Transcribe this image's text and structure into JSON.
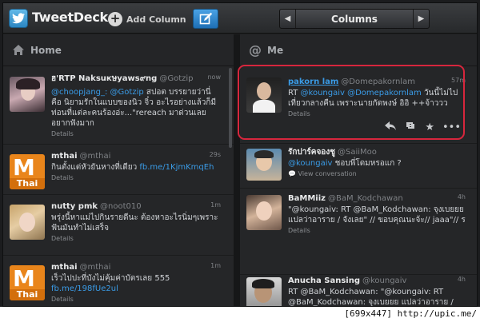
{
  "app": {
    "title": "TweetDeck",
    "add_column": "Add Column"
  },
  "column_nav": {
    "label": "Columns",
    "left": "◀",
    "right": "▶"
  },
  "columns": {
    "home": {
      "title": "Home",
      "tweets": [
        {
          "name": "ฮ'RTP Naksuкษyaws๙ng",
          "handle": "@Gotzip",
          "time": "now",
          "text_pre": "",
          "mention": "@choopjang_: @Gotzip",
          "text": " สปอต บรรยายว่านี่คือ นิยามรักในแบบของนิว จิ๋ว อะไรอย่างแล้วก็มีท่อนที่แต่ละคนร้องอ่ะ...\"rereach มาด่วนเลย อยากฟังมาก",
          "details": "Details"
        },
        {
          "name": "mthai",
          "handle": "@mthai",
          "time": "29s",
          "text": "กินตั้งแต่หัวยันหางที่เดียว ",
          "link": "fb.me/1KjmKmqEh",
          "details": "Details"
        },
        {
          "name": "nutty pmk",
          "handle": "@noot010",
          "time": "1m",
          "text": "พรุ่งนี้หาแม่ไปกินรายดีนะ ต้องหาอะไรนิ่มๆเพราะฟันมันทำไม่เสร็จ",
          "details": "Details"
        },
        {
          "name": "mthai",
          "handle": "@mthai",
          "time": "1m",
          "text": "เร็วไปปะที่บังไม่คุ้มค่าบัตรเลย 555 ",
          "link": "fb.me/198fUe2ul",
          "details": "Details"
        }
      ]
    },
    "me": {
      "title": "Me",
      "tweets": [
        {
          "name": "pakorn lam",
          "handle": "@Domepakornlam",
          "time": "57m",
          "rt": "RT ",
          "mention": "@koungaiv @Domepakornlam",
          "text": " วันนี้ไม่ไปเที่ยวกลางคืน เพราะนายกัดพงษ์ อิอิ ++จ้าววว",
          "details": "Details"
        },
        {
          "name": "รักปาร์คจองชู",
          "handle": "@SaiiMoo",
          "time": "",
          "mention": "@koungaiv",
          "text": " ชอบพี่โดมหรอแก ?",
          "details": "View conversation"
        },
        {
          "name": "BaMMiiz",
          "handle": "@BaM_Kodchawan",
          "time": "4h",
          "text": "\"@koungaiv: RT @BaM_Kodchawan: จุงเบยยย แปลว่าอาราย / จังเลย\" // ขอบคุณนะจ้ะ// jaaa\"// ร",
          "details": "Details"
        },
        {
          "name": "Anucha Sansing",
          "handle": "@koungaiv",
          "time": "4h",
          "text": "RT @BaM_Kodchawan: \"@koungaiv: RT @BaM_Kodchawan: จุงเบยยย แปลว่าอาราย /",
          "details": ""
        }
      ]
    }
  },
  "watermark": "[699x447] http://upic.me/",
  "colors": {
    "accent": "#3a9be6",
    "highlight_ring": "#d7263d",
    "bg": "#252628"
  }
}
